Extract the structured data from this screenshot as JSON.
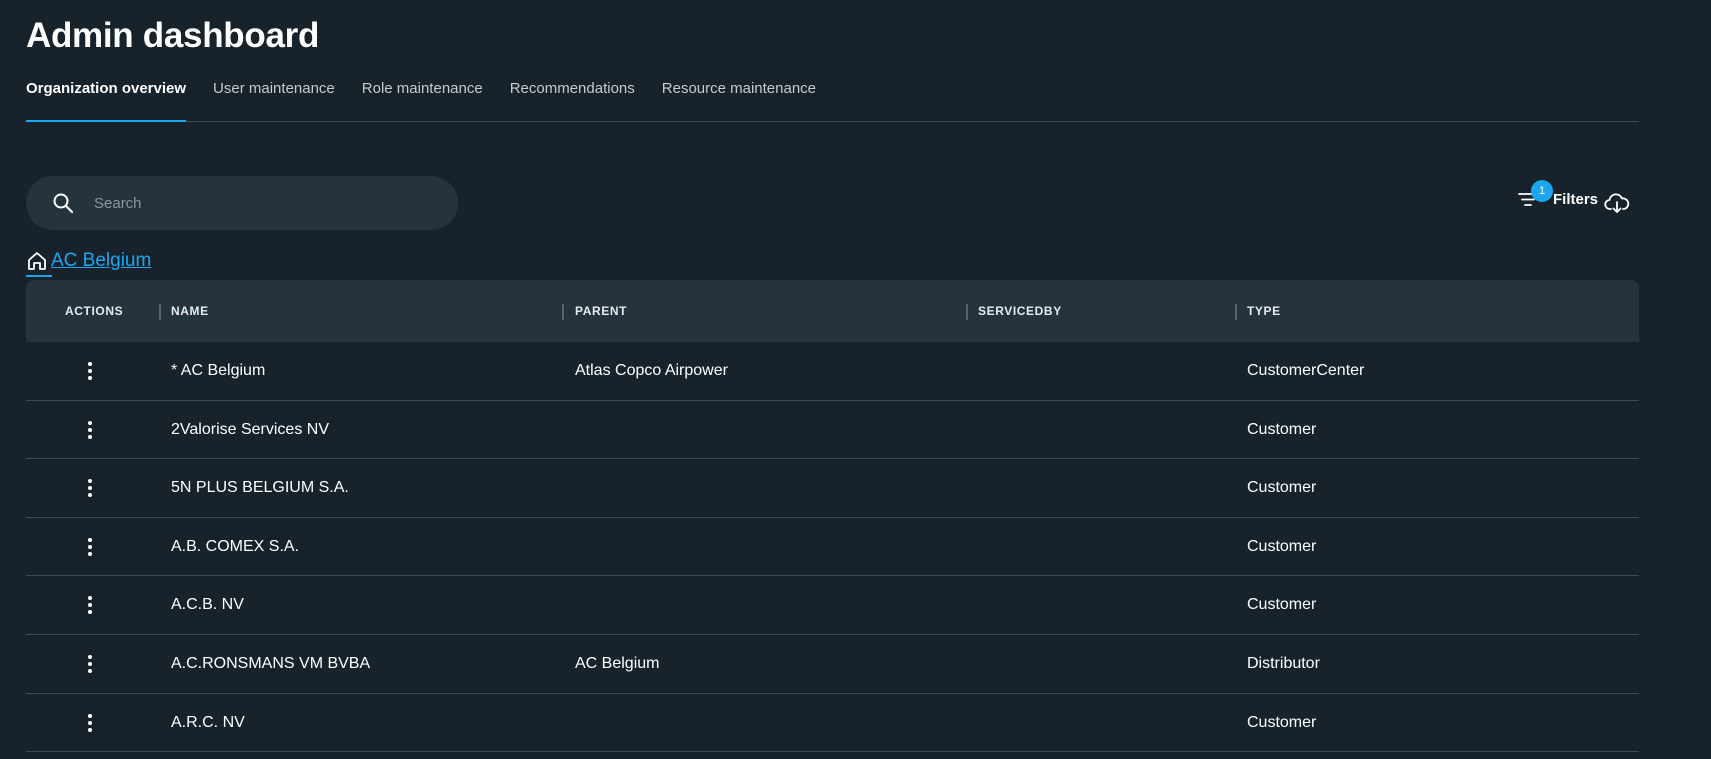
{
  "page_title": "Admin dashboard",
  "tabs": [
    {
      "label": "Organization overview",
      "active": true
    },
    {
      "label": "User maintenance",
      "active": false
    },
    {
      "label": "Role maintenance",
      "active": false
    },
    {
      "label": "Recommendations",
      "active": false
    },
    {
      "label": "Resource maintenance",
      "active": false
    }
  ],
  "search": {
    "placeholder": "Search",
    "value": ""
  },
  "filters": {
    "label": "Filters",
    "badge_count": "1"
  },
  "breadcrumb": {
    "label": "AC Belgium"
  },
  "colors": {
    "accent": "#1ba7f0",
    "background": "#17222a",
    "surface": "#25333d",
    "divider": "#3c4b56"
  },
  "table": {
    "columns": [
      "ACTIONS",
      "NAME",
      "PARENT",
      "SERVICEDBY",
      "TYPE"
    ],
    "rows": [
      {
        "name": "* AC Belgium",
        "parent": "Atlas Copco Airpower",
        "servicedby": "",
        "type": "CustomerCenter"
      },
      {
        "name": "2Valorise Services NV",
        "parent": "",
        "servicedby": "",
        "type": "Customer"
      },
      {
        "name": "5N PLUS BELGIUM S.A.",
        "parent": "",
        "servicedby": "",
        "type": "Customer"
      },
      {
        "name": "A.B. COMEX S.A.",
        "parent": "",
        "servicedby": "",
        "type": "Customer"
      },
      {
        "name": "A.C.B. NV",
        "parent": "",
        "servicedby": "",
        "type": "Customer"
      },
      {
        "name": "A.C.RONSMANS VM BVBA",
        "parent": "AC Belgium",
        "servicedby": "",
        "type": "Distributor"
      },
      {
        "name": "A.R.C. NV",
        "parent": "",
        "servicedby": "",
        "type": "Customer"
      }
    ]
  }
}
